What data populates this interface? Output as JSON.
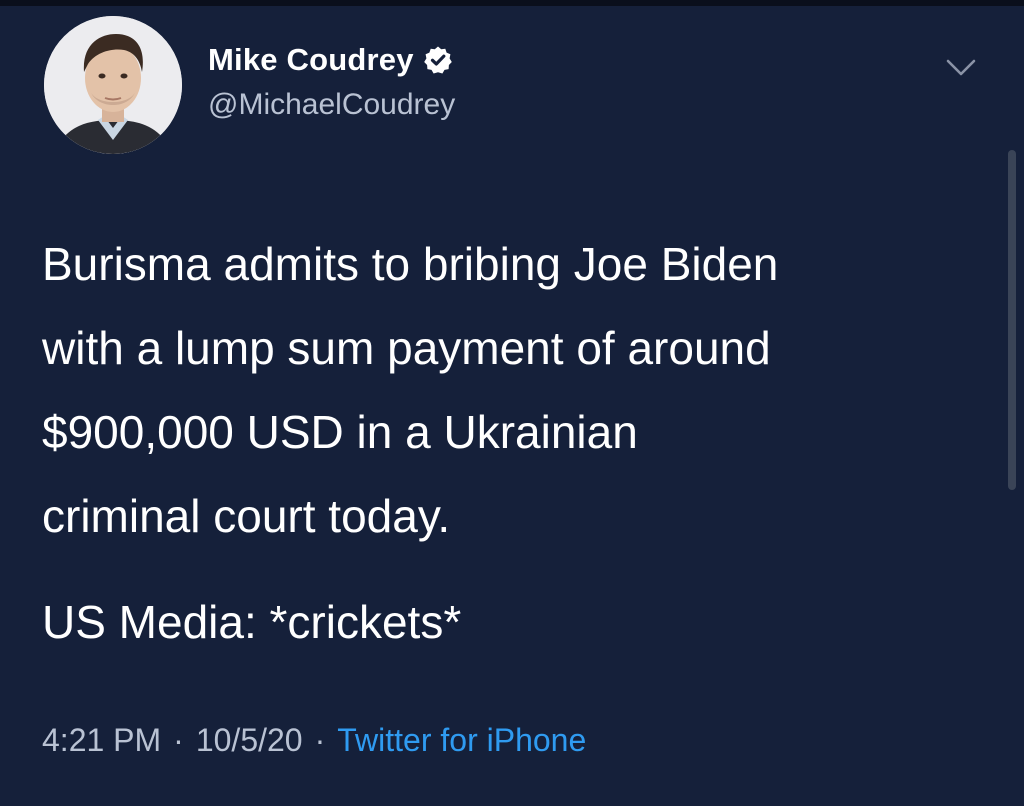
{
  "tweet": {
    "author": {
      "display_name": "Mike Coudrey",
      "handle": "@MichaelCoudrey",
      "verified": true
    },
    "text_paragraph_1": "Burisma admits to bribing Joe Biden\nwith a lump sum payment of around\n$900,000 USD in a Ukrainian\ncriminal court today.",
    "text_paragraph_2": "US Media: *crickets*",
    "meta": {
      "time": "4:21 PM",
      "separator": "·",
      "date": "10/5/20",
      "source": "Twitter for iPhone"
    }
  },
  "icons": {
    "verified": "verified-badge-icon",
    "menu": "chevron-down-icon"
  },
  "colors": {
    "background": "#15203a",
    "text": "#ffffff",
    "secondary_text": "#b9c2d3",
    "link": "#2f9bf1"
  }
}
